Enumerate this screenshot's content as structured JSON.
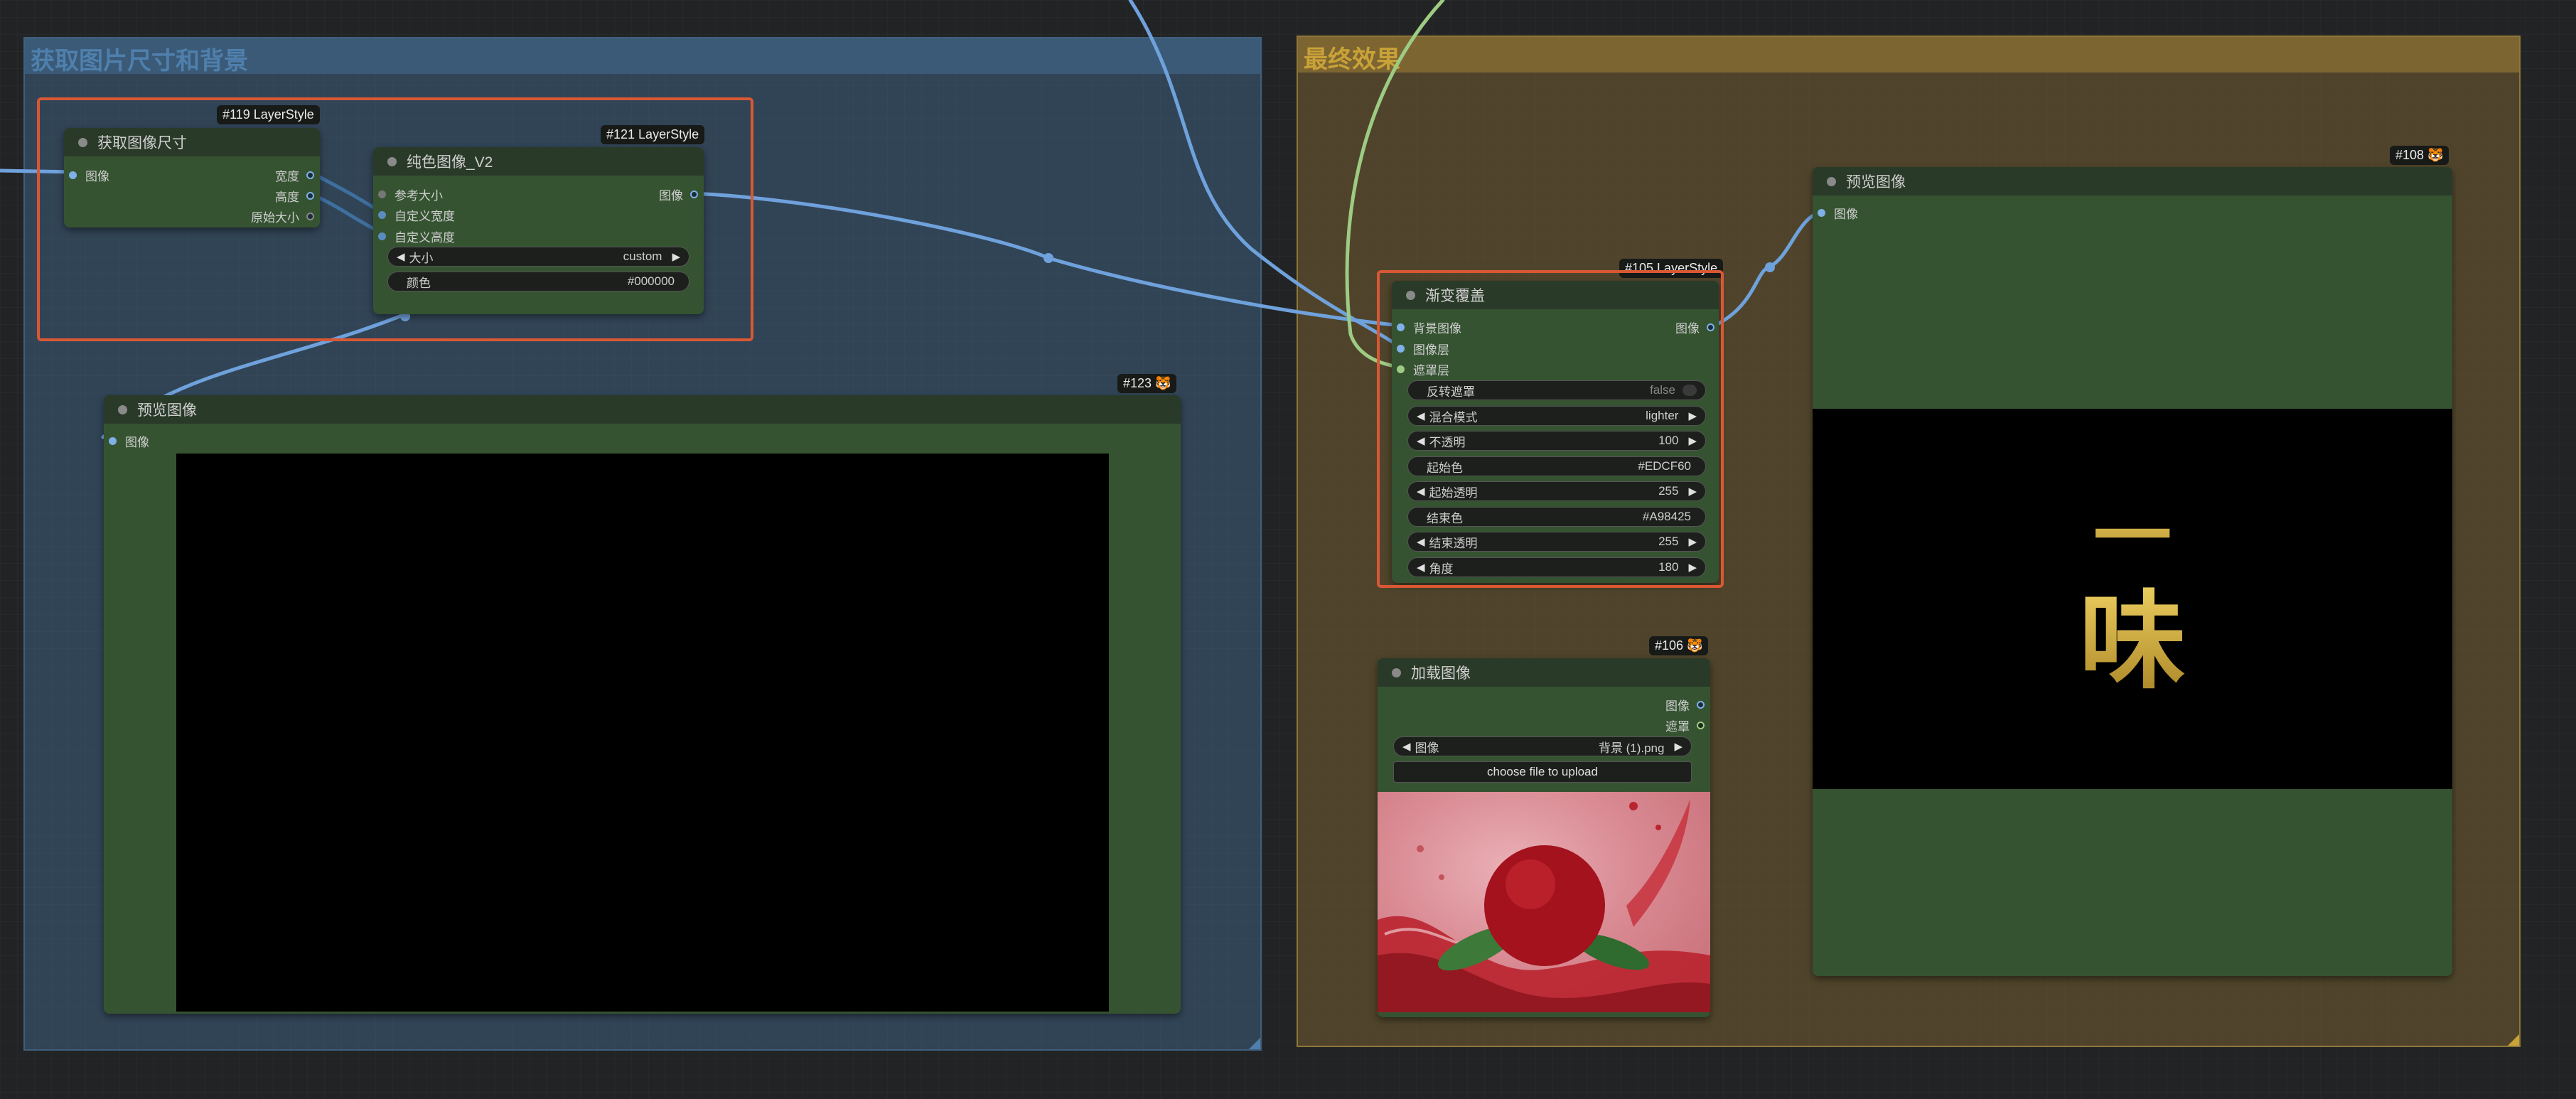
{
  "groups": {
    "left_title": "获取图片尺寸和背景",
    "right_title": "最终效果"
  },
  "colors": {
    "canvas": "#222324",
    "group_left": "#3f607e",
    "group_right": "#8e7738",
    "node_body": "#355331",
    "highlight": "#d95834",
    "image_wire": "#6fa2dc",
    "mask_wire": "#9ecb84",
    "gradient_start": "#EDCF60",
    "gradient_end": "#A98425"
  },
  "node119": {
    "badge": "#119 LayerStyle",
    "title": "获取图像尺寸",
    "input_image": "图像",
    "out_width": "宽度",
    "out_height": "高度",
    "out_original": "原始大小"
  },
  "node121": {
    "badge": "#121 LayerStyle",
    "title": "纯色图像_V2",
    "in_ref_size": "参考大小",
    "in_custom_width": "自定义宽度",
    "in_custom_height": "自定义高度",
    "out_image": "图像",
    "size_label": "大小",
    "size_value": "custom",
    "color_label": "颜色",
    "color_value": "#000000"
  },
  "node123": {
    "badge": "#123 🐯",
    "title": "预览图像",
    "input_image": "图像"
  },
  "node105": {
    "badge": "#105 LayerStyle",
    "title": "渐变覆盖",
    "in_bg": "背景图像",
    "in_layer": "图像层",
    "in_mask": "遮罩层",
    "out_image": "图像",
    "widgets": [
      {
        "label": "反转遮罩",
        "value": "false",
        "kind": "toggle"
      },
      {
        "label": "混合模式",
        "value": "lighter",
        "kind": "combo"
      },
      {
        "label": "不透明",
        "value": "100",
        "kind": "number"
      },
      {
        "label": "起始色",
        "value": "#EDCF60",
        "kind": "text"
      },
      {
        "label": "起始透明",
        "value": "255",
        "kind": "number"
      },
      {
        "label": "结束色",
        "value": "#A98425",
        "kind": "text"
      },
      {
        "label": "结束透明",
        "value": "255",
        "kind": "number"
      },
      {
        "label": "角度",
        "value": "180",
        "kind": "number"
      }
    ]
  },
  "node106": {
    "badge": "#106 🐯",
    "title": "加载图像",
    "out_image": "图像",
    "out_mask": "遮罩",
    "image_label": "图像",
    "image_value": "背景 (1).png",
    "upload_label": "choose file to upload",
    "preview_icon": "bayberry-in-red-splash-image"
  },
  "node108": {
    "badge": "#108 🐯",
    "title": "预览图像",
    "input_image": "图像",
    "preview_text_line1": "一",
    "preview_text_line2": "味"
  }
}
